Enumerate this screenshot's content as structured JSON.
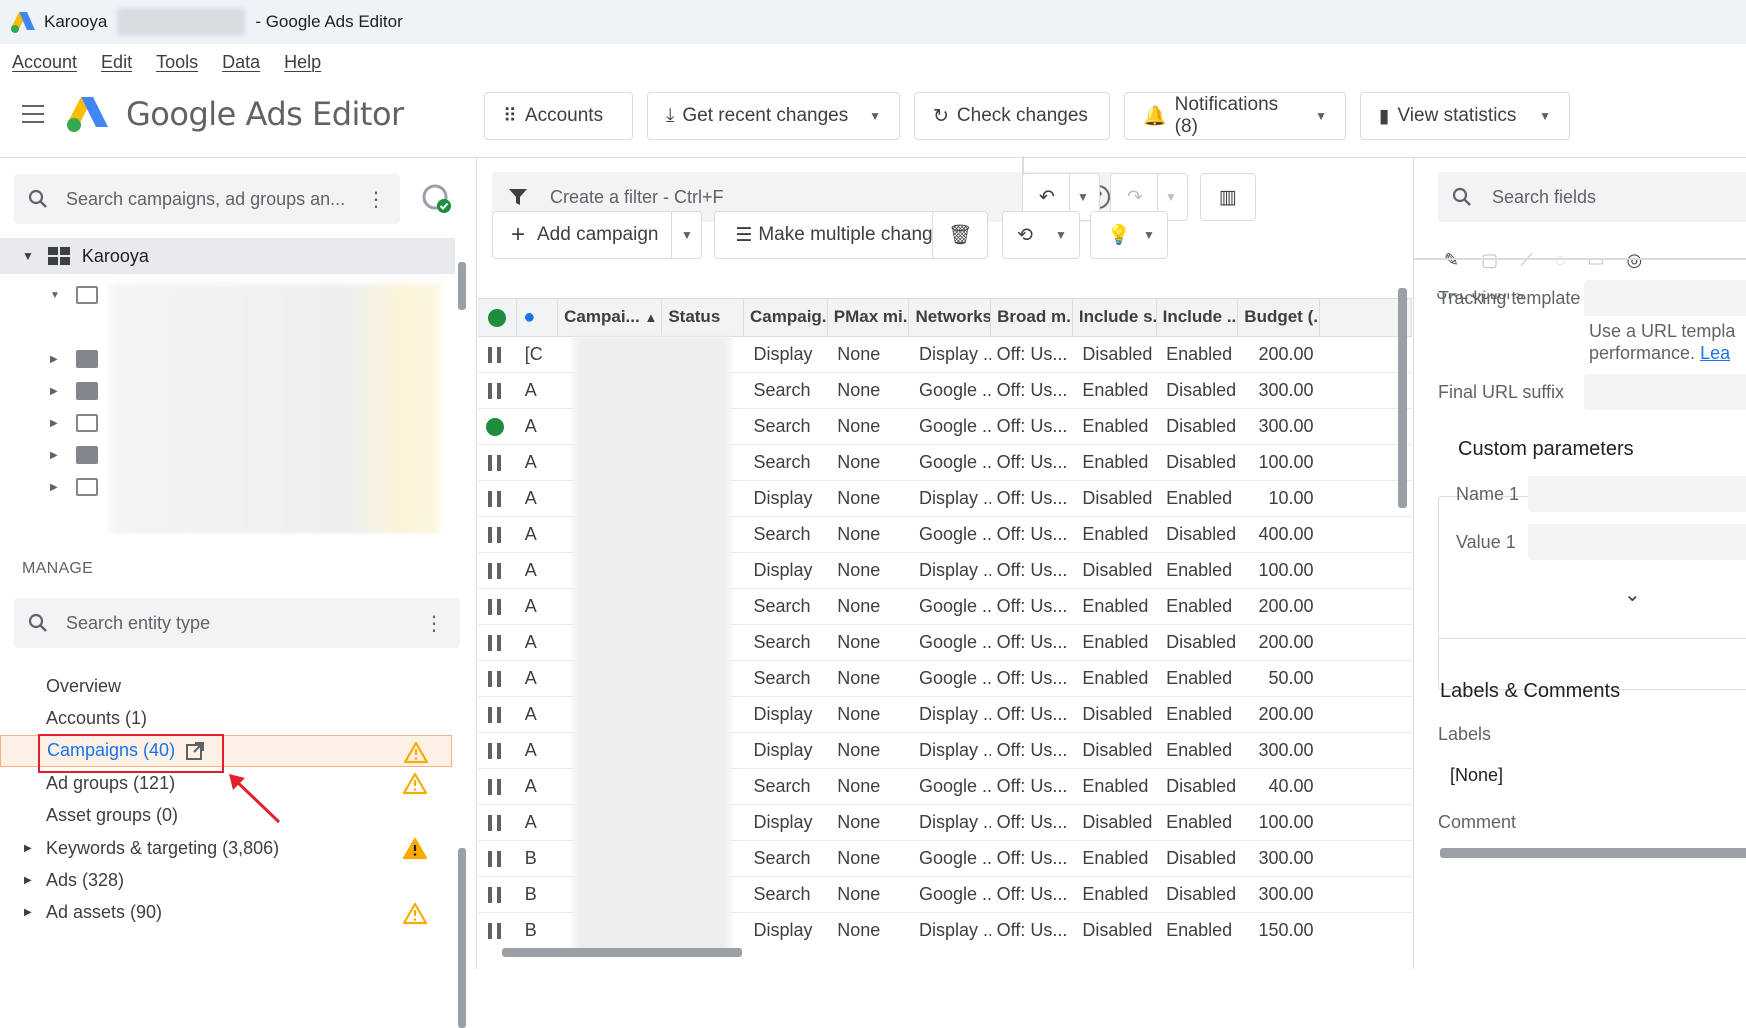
{
  "window": {
    "title_app": "Karooya",
    "title_suffix": "- Google Ads Editor"
  },
  "menu": [
    "Account",
    "Edit",
    "Tools",
    "Data",
    "Help"
  ],
  "brand": "Google Ads Editor",
  "toolbar": {
    "accounts": "Accounts",
    "get_recent": "Get recent changes",
    "check_changes": "Check changes",
    "notifications": "Notifications (8)",
    "view_statistics": "View statistics"
  },
  "left": {
    "search_placeholder": "Search campaigns, ad groups an...",
    "root_account": "Karooya",
    "manage_heading": "MANAGE",
    "entity_search_placeholder": "Search entity type",
    "manage_items": [
      {
        "label": "Overview",
        "expandable": false,
        "warning": false,
        "active": false
      },
      {
        "label": "Accounts (1)",
        "expandable": false,
        "warning": false,
        "active": false
      },
      {
        "label": "Campaigns (40)",
        "expandable": false,
        "warning": true,
        "active": true
      },
      {
        "label": "Ad groups (121)",
        "expandable": false,
        "warning": true,
        "active": false
      },
      {
        "label": "Asset groups (0)",
        "expandable": false,
        "warning": false,
        "active": false
      },
      {
        "label": "Keywords & targeting (3,806)",
        "expandable": true,
        "warning": true,
        "warning_filled": true,
        "active": false
      },
      {
        "label": "Ads (328)",
        "expandable": true,
        "warning": false,
        "active": false
      },
      {
        "label": "Ad assets (90)",
        "expandable": true,
        "warning": true,
        "active": false
      }
    ]
  },
  "center": {
    "filter_placeholder": "Create a filter - Ctrl+F",
    "add_campaign": "Add campaign",
    "make_multiple": "Make multiple changes",
    "columns": [
      "Campai...",
      "Status",
      "Campaig...",
      "PMax mi...",
      "Networks",
      "Broad m...",
      "Include s...",
      "Include ...",
      "Budget (..."
    ],
    "rows": [
      {
        "state": "paused",
        "initial": "[C",
        "type": "Display",
        "pmax": "None",
        "networks": "Display ...",
        "broad": "Off: Us...",
        "inc_s": "Disabled",
        "inc": "Enabled",
        "budget": "200.00"
      },
      {
        "state": "paused",
        "initial": "A",
        "type": "Search",
        "pmax": "None",
        "networks": "Google ...",
        "broad": "Off: Us...",
        "inc_s": "Enabled",
        "inc": "Disabled",
        "budget": "300.00"
      },
      {
        "state": "enabled",
        "initial": "A",
        "type": "Search",
        "pmax": "None",
        "networks": "Google ...",
        "broad": "Off: Us...",
        "inc_s": "Enabled",
        "inc": "Disabled",
        "budget": "300.00"
      },
      {
        "state": "paused",
        "initial": "A",
        "type": "Search",
        "pmax": "None",
        "networks": "Google ...",
        "broad": "Off: Us...",
        "inc_s": "Enabled",
        "inc": "Disabled",
        "budget": "100.00"
      },
      {
        "state": "paused",
        "initial": "A",
        "type": "Display",
        "pmax": "None",
        "networks": "Display ...",
        "broad": "Off: Us...",
        "inc_s": "Disabled",
        "inc": "Enabled",
        "budget": "10.00"
      },
      {
        "state": "paused",
        "initial": "A",
        "type": "Search",
        "pmax": "None",
        "networks": "Google ...",
        "broad": "Off: Us...",
        "inc_s": "Enabled",
        "inc": "Disabled",
        "budget": "400.00"
      },
      {
        "state": "paused",
        "initial": "A",
        "type": "Display",
        "pmax": "None",
        "networks": "Display ...",
        "broad": "Off: Us...",
        "inc_s": "Disabled",
        "inc": "Enabled",
        "budget": "100.00"
      },
      {
        "state": "paused",
        "initial": "A",
        "type": "Search",
        "pmax": "None",
        "networks": "Google ...",
        "broad": "Off: Us...",
        "inc_s": "Enabled",
        "inc": "Enabled",
        "budget": "200.00"
      },
      {
        "state": "paused",
        "initial": "A",
        "type": "Search",
        "pmax": "None",
        "networks": "Google ...",
        "broad": "Off: Us...",
        "inc_s": "Enabled",
        "inc": "Disabled",
        "budget": "200.00"
      },
      {
        "state": "paused",
        "initial": "A",
        "type": "Search",
        "pmax": "None",
        "networks": "Google ...",
        "broad": "Off: Us...",
        "inc_s": "Enabled",
        "inc": "Enabled",
        "budget": "50.00"
      },
      {
        "state": "paused",
        "initial": "A",
        "type": "Display",
        "pmax": "None",
        "networks": "Display ...",
        "broad": "Off: Us...",
        "inc_s": "Disabled",
        "inc": "Enabled",
        "budget": "200.00"
      },
      {
        "state": "paused",
        "initial": "A",
        "type": "Display",
        "pmax": "None",
        "networks": "Display ...",
        "broad": "Off: Us...",
        "inc_s": "Disabled",
        "inc": "Enabled",
        "budget": "300.00"
      },
      {
        "state": "paused",
        "initial": "A",
        "type": "Search",
        "pmax": "None",
        "networks": "Google ...",
        "broad": "Off: Us...",
        "inc_s": "Enabled",
        "inc": "Disabled",
        "budget": "40.00"
      },
      {
        "state": "paused",
        "initial": "A",
        "type": "Display",
        "pmax": "None",
        "networks": "Display ...",
        "broad": "Off: Us...",
        "inc_s": "Disabled",
        "inc": "Enabled",
        "budget": "100.00"
      },
      {
        "state": "paused",
        "initial": "B",
        "type": "Search",
        "pmax": "None",
        "networks": "Google ...",
        "broad": "Off: Us...",
        "inc_s": "Enabled",
        "inc": "Disabled",
        "budget": "300.00"
      },
      {
        "state": "paused",
        "initial": "B",
        "type": "Search",
        "pmax": "None",
        "networks": "Google ...",
        "broad": "Off: Us...",
        "inc_s": "Enabled",
        "inc": "Disabled",
        "budget": "300.00"
      },
      {
        "state": "paused",
        "initial": "B",
        "type": "Display",
        "pmax": "None",
        "networks": "Display ...",
        "broad": "Off: Us...",
        "inc_s": "Disabled",
        "inc": "Enabled",
        "budget": "150.00"
      }
    ]
  },
  "right": {
    "search_placeholder": "Search fields",
    "section_cut": "URL options",
    "tracking_template": "Tracking template",
    "url_help": "Use a URL templa",
    "url_help2": "performance.",
    "learn": "Lea",
    "final_url_suffix": "Final URL suffix",
    "custom_params": "Custom parameters",
    "name1": "Name 1",
    "value1": "Value 1",
    "labels_comments": "Labels & Comments",
    "labels": "Labels",
    "labels_value": "[None]",
    "comment": "Comment"
  },
  "colors": {
    "accent": "#1a73e8",
    "warning": "#f9ab00",
    "enabled": "#1e8e3e",
    "highlight": "#e0202a"
  }
}
